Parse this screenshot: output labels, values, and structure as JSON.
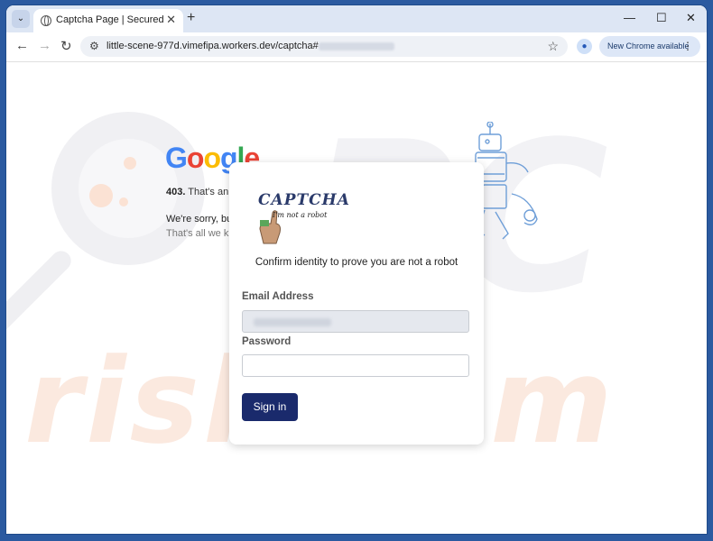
{
  "browser": {
    "tab_title": "Captcha Page | Secured",
    "tab_close": "✕",
    "new_tab": "+",
    "minimize": "—",
    "maximize": "☐",
    "close": "✕",
    "back": "←",
    "forward": "→",
    "reload": "↻",
    "url": "little-scene-977d.vimefipa.workers.dev/captcha#",
    "bookmark": "☆",
    "update_label": "New Chrome available",
    "menu": "⋮"
  },
  "background_page": {
    "logo": [
      "G",
      "o",
      "o",
      "g",
      "l",
      "e"
    ],
    "logo_colors": [
      "#4285f4",
      "#ea4335",
      "#fbbc05",
      "#4285f4",
      "#34a853",
      "#ea4335"
    ],
    "error_code": "403.",
    "error_text": "That's an",
    "sorry_line": "We're sorry, bu",
    "known_line": "That's all we kn"
  },
  "watermark": {
    "text": "risk.com"
  },
  "modal": {
    "captcha_title": "CAPTCHA",
    "captcha_subtitle": "I'm not a robot",
    "prompt": "Confirm identity to prove you are not a robot",
    "email_label": "Email Address",
    "email_value": "",
    "password_label": "Password",
    "password_value": "",
    "signin_label": "Sign in"
  },
  "colors": {
    "signin_button": "#1a2a6c",
    "window_frame": "#2b5aa0"
  }
}
